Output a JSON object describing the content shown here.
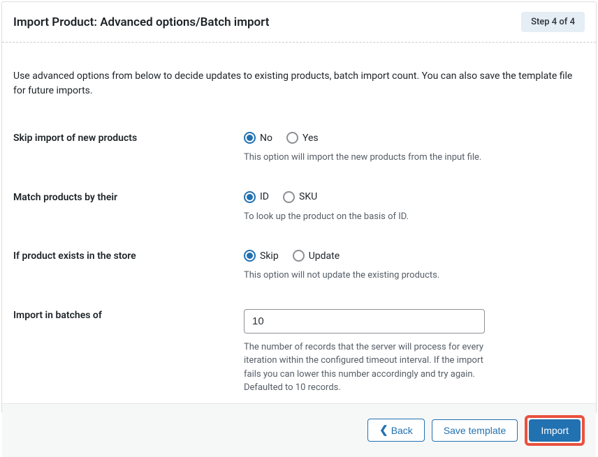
{
  "header": {
    "title": "Import Product: Advanced options/Batch import",
    "step_label": "Step 4 of 4"
  },
  "intro": "Use advanced options from below to decide updates to existing products, batch import count. You can also save the template file for future imports.",
  "fields": {
    "skip_new": {
      "label": "Skip import of new products",
      "option_no": "No",
      "option_yes": "Yes",
      "help": "This option will import the new products from the input file."
    },
    "match_by": {
      "label": "Match products by their",
      "option_id": "ID",
      "option_sku": "SKU",
      "help": "To look up the product on the basis of ID."
    },
    "if_exists": {
      "label": "If product exists in the store",
      "option_skip": "Skip",
      "option_update": "Update",
      "help": "This option will not update the existing products."
    },
    "batches": {
      "label": "Import in batches of",
      "value": "10",
      "help": "The number of records that the server will process for every iteration within the configured timeout interval. If the import fails you can lower this number accordingly and try again. Defaulted to 10 records."
    }
  },
  "footer": {
    "back": "Back",
    "save_template": "Save template",
    "import": "Import"
  }
}
